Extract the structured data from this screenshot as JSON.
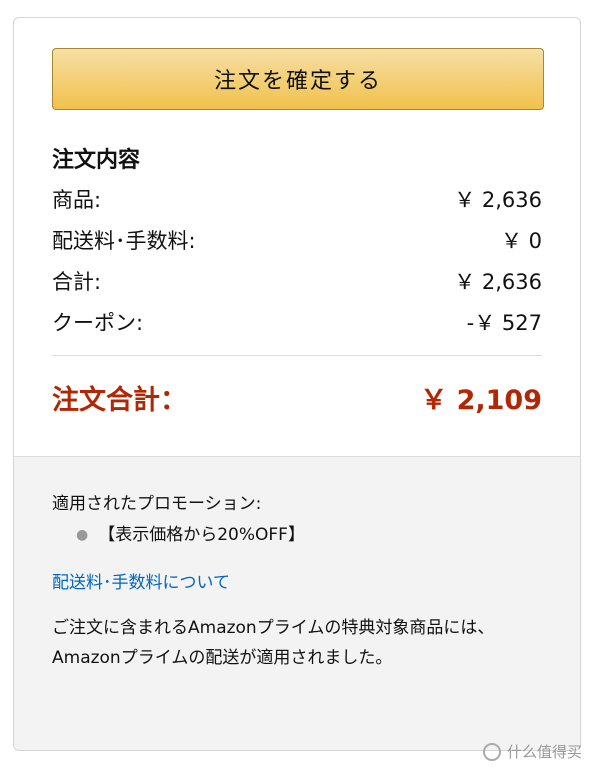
{
  "order": {
    "place_order_label": "注文を確定する",
    "summary_title": "注文内容",
    "items_label": "商品:",
    "items_value": "￥ 2,636",
    "shipping_label": "配送料･手数料:",
    "shipping_value": "￥ 0",
    "subtotal_label": "合計:",
    "subtotal_value": "￥ 2,636",
    "coupon_label": "クーポン:",
    "coupon_value": "-￥ 527",
    "total_label": "注文合計：",
    "total_value": "￥ 2,109"
  },
  "promotions": {
    "heading": "適用されたプロモーション:",
    "items": [
      "【表示価格から20%OFF】"
    ],
    "shipping_link": "配送料･手数料について",
    "prime_note": "ご注文に含まれるAmazonプライムの特典対象商品には、Amazonプライムの配送が適用されました。"
  },
  "watermark": {
    "text": "什么值得买"
  },
  "colors": {
    "total": "#b12704",
    "link": "#0066c0",
    "button": "#f0c14b"
  }
}
